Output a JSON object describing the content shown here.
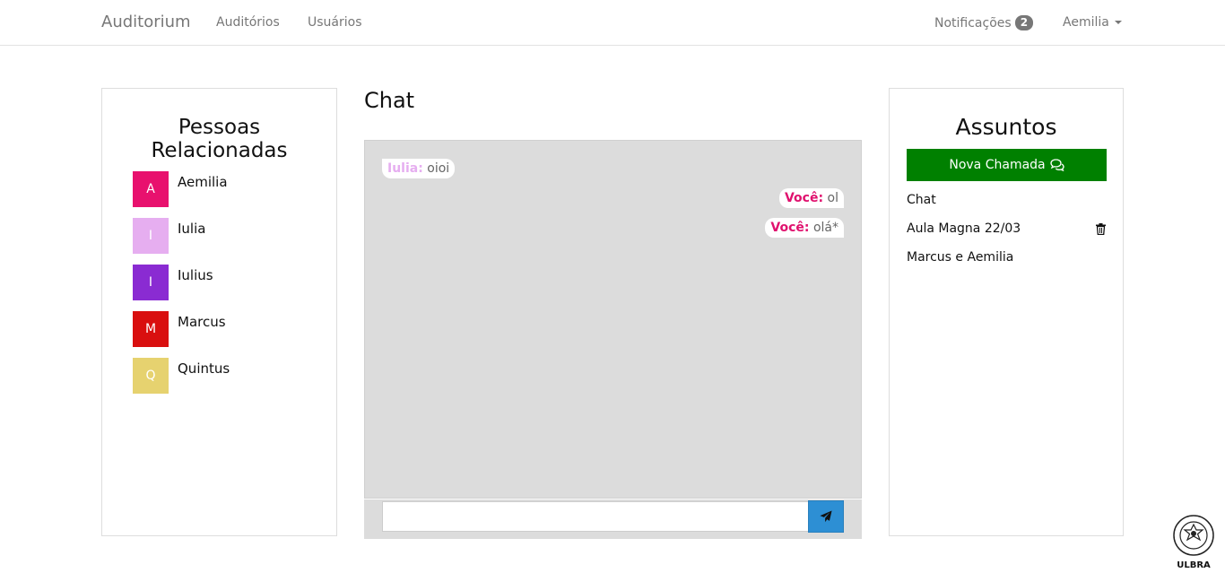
{
  "navbar": {
    "brand": "Auditorium",
    "links": [
      "Auditórios",
      "Usuários"
    ],
    "notifications_label": "Notificações",
    "notifications_count": "2",
    "user_name": "Aemilia"
  },
  "people_panel": {
    "title_line1": "Pessoas",
    "title_line2": "Relacionadas",
    "people": [
      {
        "initial": "A",
        "name": "Aemilia",
        "color": "#e8116e"
      },
      {
        "initial": "I",
        "name": "Iulia",
        "color": "#e6aef0"
      },
      {
        "initial": "I",
        "name": "Iulius",
        "color": "#8a2bd2"
      },
      {
        "initial": "M",
        "name": "Marcus",
        "color": "#d90f0f"
      },
      {
        "initial": "Q",
        "name": "Quintus",
        "color": "#e6d26f"
      }
    ]
  },
  "chat": {
    "title": "Chat",
    "messages": [
      {
        "sender": "Iulia:",
        "text": "oioi"
      },
      {
        "sender": "Você:",
        "text": "ol"
      },
      {
        "sender": "Você:",
        "text": "olá*"
      }
    ],
    "input_value": "",
    "send_icon": "paper-plane-icon"
  },
  "topics_panel": {
    "title": "Assuntos",
    "new_call_label": "Nova Chamada",
    "topics": [
      "Chat",
      "Aula Magna 22/03",
      "Marcus e Aemilia"
    ]
  },
  "colors": {
    "accent_green": "#008000",
    "send_blue": "#2d8fd4",
    "chat_background": "#dcdcdc"
  }
}
